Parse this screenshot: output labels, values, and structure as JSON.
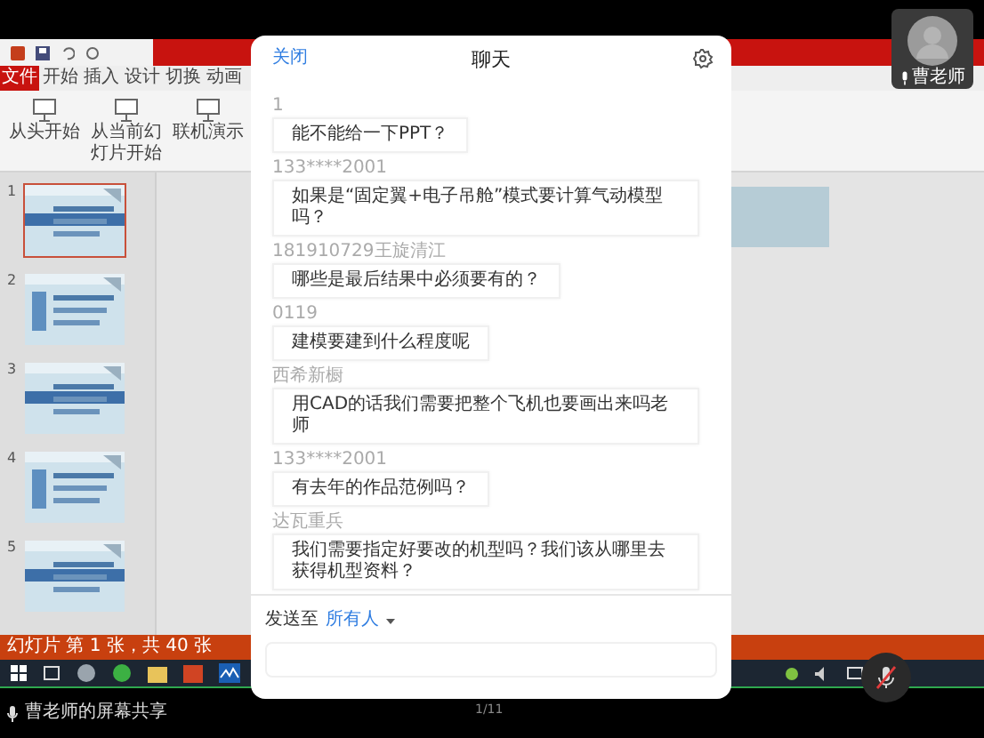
{
  "presentation": {
    "ribbon_tabs": [
      {
        "label": "文件",
        "selected": true
      },
      {
        "label": "开始",
        "selected": false
      },
      {
        "label": "插入",
        "selected": false
      },
      {
        "label": "设计",
        "selected": false
      },
      {
        "label": "切换",
        "selected": false
      },
      {
        "label": "动画",
        "selected": false
      }
    ],
    "ribbon_buttons": [
      "从头开始",
      "从当前幻灯片开始",
      "联机演示"
    ],
    "slides": [
      {
        "number": "1",
        "selected": true
      },
      {
        "number": "2",
        "selected": false
      },
      {
        "number": "3",
        "selected": false
      },
      {
        "number": "4",
        "selected": false
      },
      {
        "number": "5",
        "selected": false
      }
    ],
    "status": "幻灯片 第 1 张，共 40 张"
  },
  "video_tile": {
    "name": "曹老师"
  },
  "chat": {
    "close": "关闭",
    "title": "聊天",
    "messages": [
      {
        "sender": "1",
        "text": "能不能给一下PPT？"
      },
      {
        "sender": "133****2001",
        "text": "如果是“固定翼+电子吊舱”模式要计算气动模型吗？"
      },
      {
        "sender": "181910729王旋清江",
        "text": "哪些是最后结果中必须要有的？"
      },
      {
        "sender": "0119",
        "text": "建模要建到什么程度呢"
      },
      {
        "sender": "西希新橱",
        "text": "用CAD的话我们需要把整个飞机也要画出来吗老师"
      },
      {
        "sender": "133****2001",
        "text": "有去年的作品范例吗？"
      },
      {
        "sender": "达瓦重兵",
        "text": "我们需要指定好要改的机型吗？我们该从哪里去获得机型资料？"
      }
    ],
    "send_to_label": "发送至",
    "recipient": "所有人"
  },
  "page_indicator": "1/11",
  "share_label": "曹老师的屏幕共享"
}
